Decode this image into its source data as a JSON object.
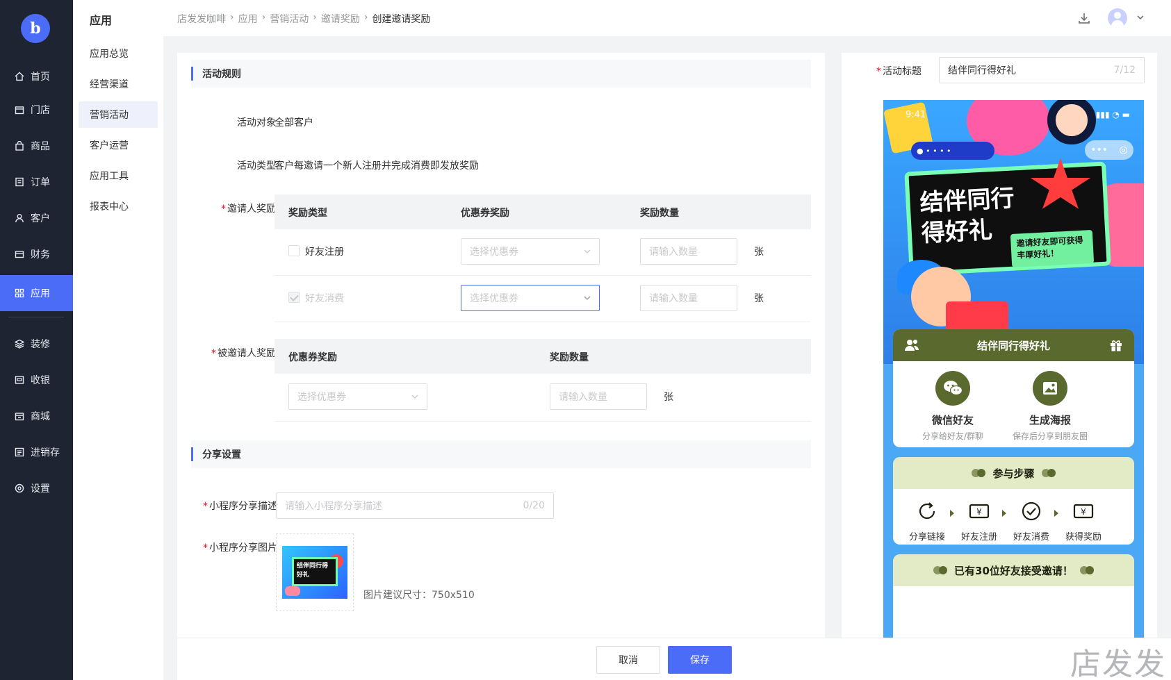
{
  "nav": {
    "logo": "b",
    "items": [
      {
        "label": "首页",
        "icon": "home-icon"
      },
      {
        "label": "门店",
        "icon": "store-icon"
      },
      {
        "label": "商品",
        "icon": "bag-icon"
      },
      {
        "label": "订单",
        "icon": "order-icon"
      },
      {
        "label": "客户",
        "icon": "user-icon"
      },
      {
        "label": "财务",
        "icon": "wallet-icon"
      },
      {
        "label": "应用",
        "icon": "apps-icon",
        "active": true
      },
      {
        "label": "装修",
        "icon": "layers-icon"
      },
      {
        "label": "收银",
        "icon": "cashier-icon"
      },
      {
        "label": "商城",
        "icon": "mall-icon"
      },
      {
        "label": "进销存",
        "icon": "inventory-icon"
      },
      {
        "label": "设置",
        "icon": "settings-icon"
      }
    ]
  },
  "subnav": {
    "title": "应用",
    "items": [
      "应用总览",
      "经营渠道",
      "营销活动",
      "客户运营",
      "应用工具",
      "报表中心"
    ],
    "active_index": 2
  },
  "breadcrumb": [
    "店发发咖啡",
    "应用",
    "营销活动",
    "邀请奖励",
    "创建邀请奖励"
  ],
  "form": {
    "section_rules": "活动规则",
    "target_label": "活动对象",
    "target_value": "全部客户",
    "type_label": "活动类型",
    "type_value": "客户每邀请一个新人注册并完成消费即发放奖励",
    "inviter_label": "邀请人奖励",
    "inviter_table": {
      "headers": [
        "奖励类型",
        "优惠券奖励",
        "奖励数量"
      ],
      "rows": [
        {
          "type": "好友注册",
          "checked": false,
          "coupon_placeholder": "选择优惠券",
          "qty_placeholder": "请输入数量",
          "unit": "张"
        },
        {
          "type": "好友消费",
          "checked": true,
          "coupon_placeholder": "选择优惠券",
          "qty_placeholder": "请输入数量",
          "unit": "张"
        }
      ]
    },
    "invitee_label": "被邀请人奖励",
    "invitee_table": {
      "headers": [
        "优惠券奖励",
        "奖励数量"
      ],
      "coupon_placeholder": "选择优惠券",
      "qty_placeholder": "请输入数量",
      "unit": "张"
    },
    "section_share": "分享设置",
    "share_desc_label": "小程序分享描述",
    "share_desc_placeholder": "请输入小程序分享描述",
    "share_desc_count": "0/20",
    "share_img_label": "小程序分享图片",
    "share_img_hint": "图片建议尺寸：750x510",
    "thumb_text": "结伴同行得好礼"
  },
  "footer": {
    "cancel": "取消",
    "save": "保存",
    "watermark": "店发发"
  },
  "preview": {
    "title_label": "活动标题",
    "title_value": "结伴同行得好礼",
    "title_count": "7/12",
    "status_time": "9:41",
    "banner_line1": "结伴同行",
    "banner_line2": "得好礼",
    "banner_sub": "邀请好友即可获得丰厚好礼！",
    "share_card_title": "结伴同行得好礼",
    "share_options": [
      {
        "title": "微信好友",
        "desc": "分享给好友/群聊",
        "icon": "wechat-icon"
      },
      {
        "title": "生成海报",
        "desc": "保存后分享到朋友圈",
        "icon": "image-icon"
      }
    ],
    "steps_title": "参与步骤",
    "steps": [
      {
        "label": "分享链接",
        "icon": "share-link-icon"
      },
      {
        "label": "好友注册",
        "icon": "coupon-icon"
      },
      {
        "label": "好友消费",
        "icon": "check-circle-icon"
      },
      {
        "label": "获得奖励",
        "icon": "reward-icon"
      }
    ],
    "invite_text": "已有30位好友接受邀请！"
  },
  "colors": {
    "accent": "#4a6cf7",
    "nav_bg": "#1f2433",
    "olive": "#5a6a2e",
    "pale_green": "#e2ebc6",
    "required": "#ee0a24"
  }
}
